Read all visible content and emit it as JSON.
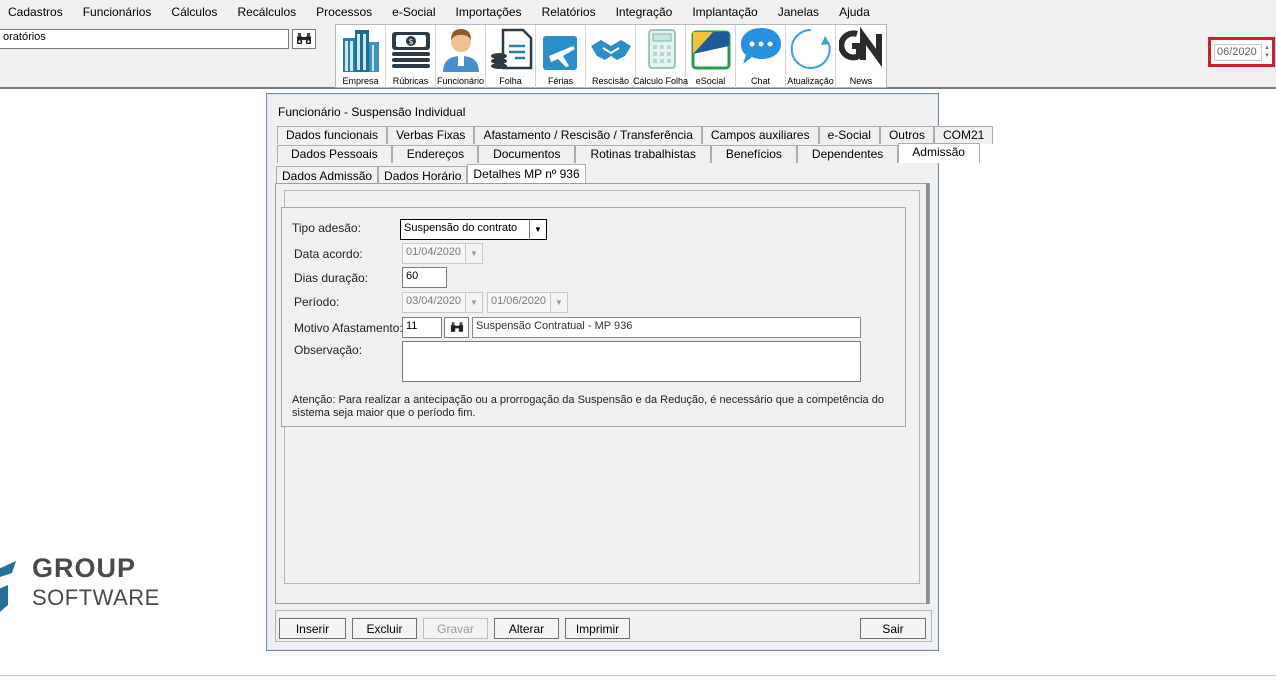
{
  "menu": {
    "items": [
      "Cadastros",
      "Funcionários",
      "Cálculos",
      "Recálculos",
      "Processos",
      "e-Social",
      "Importações",
      "Relatórios",
      "Integração",
      "Implantação",
      "Janelas",
      "Ajuda"
    ]
  },
  "toolbar": {
    "search_value": "oratórios",
    "shortcuts": [
      {
        "label": "Empresa",
        "icon": "building-icon"
      },
      {
        "label": "Rúbricas",
        "icon": "money-stack-icon"
      },
      {
        "label": "Funcionário",
        "icon": "employee-icon"
      },
      {
        "label": "Folha",
        "icon": "payroll-document-icon"
      },
      {
        "label": "Férias",
        "icon": "airplane-icon"
      },
      {
        "label": "Rescisão",
        "icon": "handshake-icon"
      },
      {
        "label": "Cálculo Folha",
        "icon": "calculator-icon"
      },
      {
        "label": "eSocial",
        "icon": "esocial-icon"
      },
      {
        "label": "Chat",
        "icon": "chat-bubble-icon"
      },
      {
        "label": "Atualização",
        "icon": "refresh-icon"
      },
      {
        "label": "News",
        "icon": "gn-news-icon"
      }
    ],
    "competencia": "06/2020"
  },
  "logo": {
    "line1": "GROUP",
    "line2": "SOFTWARE"
  },
  "dialog": {
    "title": "Funcionário - Suspensão Individual",
    "tabs_row1": [
      "Dados funcionais",
      "Verbas Fixas",
      "Afastamento / Rescisão / Transferência",
      "Campos auxiliares",
      "e-Social",
      "Outros",
      "COM21"
    ],
    "tabs_row2": [
      "Dados Pessoais",
      "Endereços",
      "Documentos",
      "Rotinas trabalhistas",
      "Benefícios",
      "Dependentes",
      "Admissão"
    ],
    "tabs_row3": [
      "Dados Admissão",
      "Dados Horário",
      "Detalhes MP nº 936"
    ],
    "form": {
      "tipo_adesao_label": "Tipo adesão:",
      "tipo_adesao_value": "Suspensão do contrato",
      "data_acordo_label": "Data acordo:",
      "data_acordo_value": "01/04/2020",
      "dias_duracao_label": "Dias duração:",
      "dias_duracao_value": "60",
      "periodo_label": "Período:",
      "periodo_inicio": "03/04/2020",
      "periodo_fim": "01/06/2020",
      "motivo_label": "Motivo Afastamento:",
      "motivo_codigo": "11",
      "motivo_descricao": "Suspensão Contratual - MP 936",
      "observacao_label": "Observação:",
      "observacao_value": "",
      "attention": "Atenção: Para realizar a antecipação ou a prorrogação da Suspensão e da Redução, é necessário que a competência do sistema seja maior que o período fim."
    },
    "buttons": {
      "inserir": "Inserir",
      "excluir": "Excluir",
      "gravar": "Gravar",
      "alterar": "Alterar",
      "imprimir": "Imprimir",
      "sair": "Sair"
    }
  },
  "colors": {
    "highlight_border": "#d0202a",
    "dialog_border": "#6f8db4",
    "window_bg": "#f0f0f0"
  }
}
